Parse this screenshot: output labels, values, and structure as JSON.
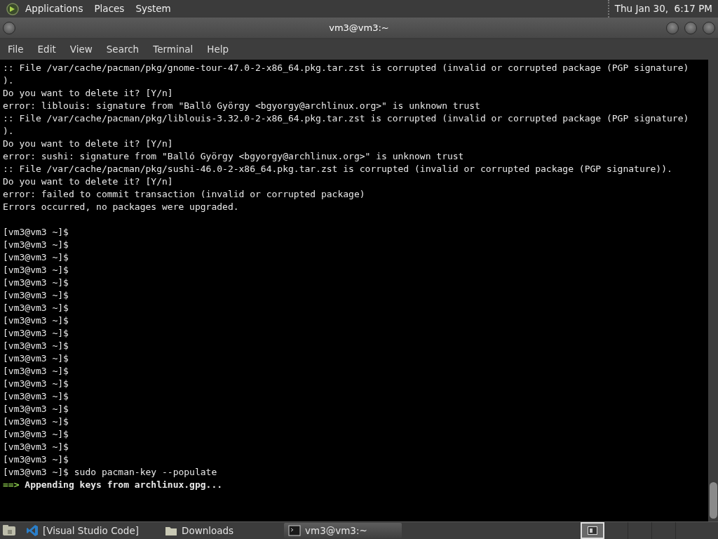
{
  "top_panel": {
    "menus": [
      "Applications",
      "Places",
      "System"
    ],
    "clock": "Thu Jan 30,  6:17 PM"
  },
  "window": {
    "title": "vm3@vm3:~"
  },
  "menubar": [
    "File",
    "Edit",
    "View",
    "Search",
    "Terminal",
    "Help"
  ],
  "terminal": {
    "lines": [
      {
        "kind": "text",
        "text": ":: File /var/cache/pacman/pkg/gnome-tour-47.0-2-x86_64.pkg.tar.zst is corrupted (invalid or corrupted package (PGP signature)"
      },
      {
        "kind": "text",
        "text": ")."
      },
      {
        "kind": "text",
        "text": "Do you want to delete it? [Y/n]"
      },
      {
        "kind": "text",
        "text": "error: liblouis: signature from \"Balló György <bgyorgy@archlinux.org>\" is unknown trust"
      },
      {
        "kind": "text",
        "text": ":: File /var/cache/pacman/pkg/liblouis-3.32.0-2-x86_64.pkg.tar.zst is corrupted (invalid or corrupted package (PGP signature)"
      },
      {
        "kind": "text",
        "text": ")."
      },
      {
        "kind": "text",
        "text": "Do you want to delete it? [Y/n]"
      },
      {
        "kind": "text",
        "text": "error: sushi: signature from \"Balló György <bgyorgy@archlinux.org>\" is unknown trust"
      },
      {
        "kind": "text",
        "text": ":: File /var/cache/pacman/pkg/sushi-46.0-2-x86_64.pkg.tar.zst is corrupted (invalid or corrupted package (PGP signature))."
      },
      {
        "kind": "text",
        "text": "Do you want to delete it? [Y/n]"
      },
      {
        "kind": "text",
        "text": "error: failed to commit transaction (invalid or corrupted package)"
      },
      {
        "kind": "text",
        "text": "Errors occurred, no packages were upgraded."
      },
      {
        "kind": "blank"
      },
      {
        "kind": "text",
        "text": "[vm3@vm3 ~]$"
      },
      {
        "kind": "text",
        "text": "[vm3@vm3 ~]$"
      },
      {
        "kind": "text",
        "text": "[vm3@vm3 ~]$"
      },
      {
        "kind": "text",
        "text": "[vm3@vm3 ~]$"
      },
      {
        "kind": "text",
        "text": "[vm3@vm3 ~]$"
      },
      {
        "kind": "text",
        "text": "[vm3@vm3 ~]$"
      },
      {
        "kind": "text",
        "text": "[vm3@vm3 ~]$"
      },
      {
        "kind": "text",
        "text": "[vm3@vm3 ~]$"
      },
      {
        "kind": "text",
        "text": "[vm3@vm3 ~]$"
      },
      {
        "kind": "text",
        "text": "[vm3@vm3 ~]$"
      },
      {
        "kind": "text",
        "text": "[vm3@vm3 ~]$"
      },
      {
        "kind": "text",
        "text": "[vm3@vm3 ~]$"
      },
      {
        "kind": "text",
        "text": "[vm3@vm3 ~]$"
      },
      {
        "kind": "text",
        "text": "[vm3@vm3 ~]$"
      },
      {
        "kind": "text",
        "text": "[vm3@vm3 ~]$"
      },
      {
        "kind": "text",
        "text": "[vm3@vm3 ~]$"
      },
      {
        "kind": "text",
        "text": "[vm3@vm3 ~]$"
      },
      {
        "kind": "text",
        "text": "[vm3@vm3 ~]$"
      },
      {
        "kind": "text",
        "text": "[vm3@vm3 ~]$"
      },
      {
        "kind": "text",
        "text": "[vm3@vm3 ~]$ sudo pacman-key --populate"
      },
      {
        "kind": "status",
        "marker": "==>",
        "text": "Appending keys from archlinux.gpg..."
      }
    ]
  },
  "taskbar": {
    "tasks": [
      {
        "label": "[Visual Studio Code]",
        "kind": "code",
        "selected": false
      },
      {
        "label": "Downloads",
        "kind": "folder",
        "selected": false
      },
      {
        "label": "vm3@vm3:~",
        "kind": "terminal",
        "selected": true
      }
    ],
    "workspaces": [
      {
        "selected": true
      },
      {
        "selected": false
      },
      {
        "selected": false
      },
      {
        "selected": false
      }
    ]
  }
}
